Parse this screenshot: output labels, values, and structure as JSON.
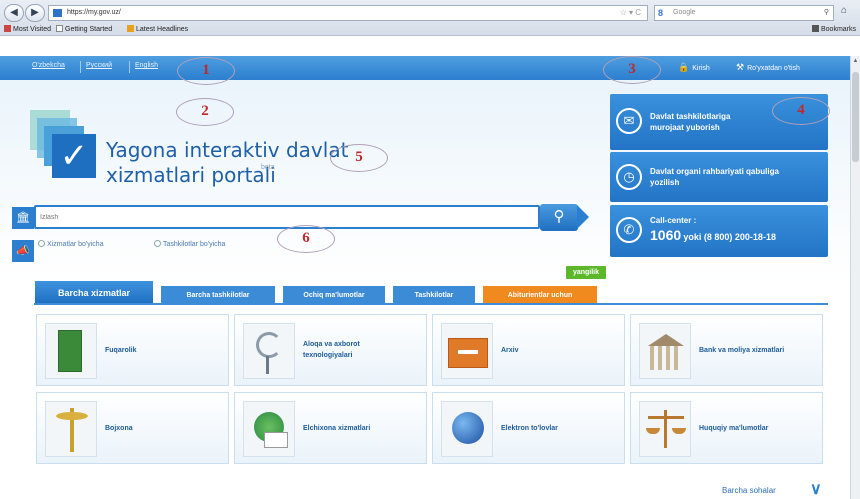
{
  "browser": {
    "url": "https://my.gov.uz/",
    "search_placeholder": "Google",
    "bookmarks": [
      "Most Visited",
      "Getting Started",
      "Latest Headlines"
    ],
    "bookmarks_right": "Bookmarks"
  },
  "topbar": {
    "languages": [
      "O'zbekcha",
      "Русский",
      "English"
    ],
    "login": "Kirish",
    "register": "Ro'yxatdan o'tish"
  },
  "portal": {
    "title_line1": "Yagona interaktiv davlat",
    "title_line2": "xizmatlari portali",
    "beta": "beta"
  },
  "search": {
    "placeholder": "Izlash",
    "radio_services": "Xizmatlar bo'yicha",
    "radio_orgs": "Tashkilotlar bo'yicha"
  },
  "cards": [
    {
      "text_line1": "Davlat tashkilotlariga",
      "text_line2": "murojaat yuborish"
    },
    {
      "text_line1": "Davlat organi rahbariyati qabuliga",
      "text_line2": "yozilish"
    },
    {
      "label": "Call-center :",
      "number": "1060",
      "rest": "yoki (8 800) 200-18-18"
    }
  ],
  "tabs": [
    "Barcha xizmatlar",
    "Barcha tashkilotlar",
    "Ochiq ma'lumotlar",
    "Tashkilotlar",
    "Abiturientlar uchun"
  ],
  "new_badge": "yangilik",
  "tiles": [
    {
      "line1": "Fuqarolik",
      "line2": "",
      "icon": "passport-icon"
    },
    {
      "line1": "Aloqa va axborot",
      "line2": "texnologiyalari",
      "icon": "satellite-icon"
    },
    {
      "line1": "Arxiv",
      "line2": "",
      "icon": "archive-icon"
    },
    {
      "line1": "Bank va moliya xizmatlari",
      "line2": "",
      "icon": "bank-icon"
    },
    {
      "line1": "Bojxona",
      "line2": "",
      "icon": "customs-icon"
    },
    {
      "line1": "Elchixona xizmatlari",
      "line2": "",
      "icon": "embassy-icon"
    },
    {
      "line1": "Elektron to'lovlar",
      "line2": "",
      "icon": "globe-icon"
    },
    {
      "line1": "Huquqiy ma'lumotlar",
      "line2": "",
      "icon": "scales-icon"
    }
  ],
  "more_link": "Barcha sohalar",
  "markers": [
    "1",
    "2",
    "3",
    "4",
    "5",
    "6"
  ],
  "colors": {
    "brand_blue": "#2c7fcf",
    "orange_tab": "#f08a1e",
    "new_green": "#5cb82a",
    "marker_red": "#c0292b"
  }
}
